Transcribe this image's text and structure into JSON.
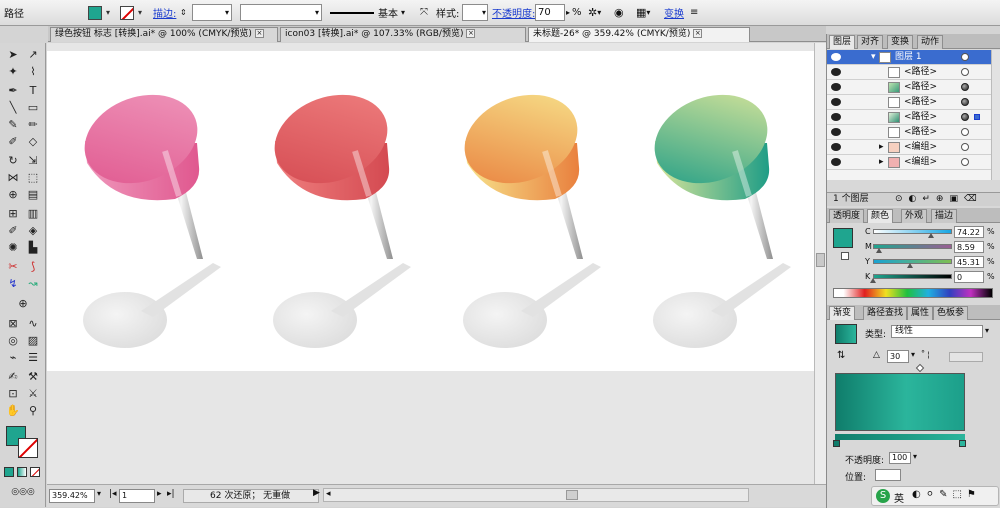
{
  "control_bar": {
    "object_type": "路径",
    "stroke_link": "描边:",
    "stroke_style": "基本",
    "style_label": "样式:",
    "opacity_link": "不透明度:",
    "opacity_value": "70",
    "opacity_unit": "%",
    "transform_link": "变换"
  },
  "doc_tabs": [
    {
      "label": "绿色按钮 标志 [转换].ai* @ 100% (CMYK/预览)"
    },
    {
      "label": "icon03 [转换].ai* @ 107.33% (RGB/预览)"
    },
    {
      "label": "未标题-26* @ 359.42% (CMYK/预览)"
    }
  ],
  "status": {
    "zoom": "359.42%",
    "page": "1",
    "info": "62 次还原； 无重做"
  },
  "layers_panel": {
    "tabs": [
      "图层",
      "对齐",
      "变换",
      "动作"
    ],
    "rows": [
      {
        "name": "图层 1"
      },
      {
        "name": "<路径>"
      },
      {
        "name": "<路径>"
      },
      {
        "name": "<路径>"
      },
      {
        "name": "<路径>"
      },
      {
        "name": "<路径>"
      },
      {
        "name": "<编组>"
      },
      {
        "name": "<编组>"
      }
    ],
    "footer": "1 个图层"
  },
  "color_panel": {
    "tabs": [
      "透明度",
      "颜色",
      "外观",
      "描边"
    ],
    "channels": [
      {
        "label": "C",
        "value": "74.22"
      },
      {
        "label": "M",
        "value": "8.59"
      },
      {
        "label": "Y",
        "value": "45.31"
      },
      {
        "label": "K",
        "value": "0"
      }
    ],
    "unit": "%",
    "swatch_color": "#1fa58f"
  },
  "gradient_panel": {
    "tabs": [
      "渐变",
      "路径查找",
      "属性",
      "色板参"
    ],
    "type_label": "类型:",
    "type_value": "线性",
    "angle": "30",
    "opacity_label": "不透明度:",
    "opacity_value": "100",
    "location_label": "位置:"
  },
  "taskbar": {
    "ime": "英"
  },
  "pins": [
    {
      "color_light": "#ef97bb",
      "color_dark": "#e0588f"
    },
    {
      "color_light": "#ef7f7f",
      "color_dark": "#d44a51"
    },
    {
      "color_light": "#f7e38c",
      "color_dark": "#e9803e"
    },
    {
      "color_light": "#d9e59a",
      "color_dark": "#1f9d86"
    }
  ]
}
